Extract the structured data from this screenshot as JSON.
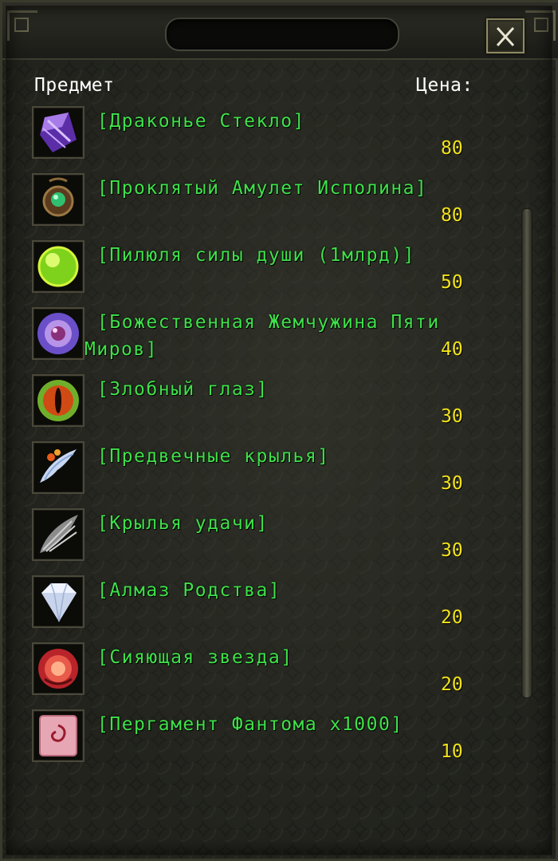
{
  "header": {
    "item_label": "Предмет",
    "price_label": "Цена:"
  },
  "colors": {
    "item_name": "#3fe14a",
    "price": "#f2e31b",
    "header_text": "#ffffff"
  },
  "items": [
    {
      "name": "[Драконье Стекло]",
      "price": "80",
      "icon": "purple-crystal-icon"
    },
    {
      "name": "[Проклятый Амулет Исполина]",
      "price": "80",
      "icon": "green-amulet-icon"
    },
    {
      "name": "[Пилюля силы души (1млрд)]",
      "price": "50",
      "icon": "green-pill-icon"
    },
    {
      "name": "[Божественная Жемчужина Пяти Миров]",
      "price": "40",
      "icon": "purple-pearl-icon"
    },
    {
      "name": "[Злобный глаз]",
      "price": "30",
      "icon": "evil-eye-icon"
    },
    {
      "name": "[Предвечные крылья]",
      "price": "30",
      "icon": "wings-icon"
    },
    {
      "name": "[Крылья удачи]",
      "price": "30",
      "icon": "grey-wing-icon"
    },
    {
      "name": "[Алмаз Родства]",
      "price": "20",
      "icon": "diamond-icon"
    },
    {
      "name": "[Сияющая звезда]",
      "price": "20",
      "icon": "red-rose-icon"
    },
    {
      "name": "[Пергамент Фантома x1000]",
      "price": "10",
      "icon": "scroll-icon"
    }
  ]
}
